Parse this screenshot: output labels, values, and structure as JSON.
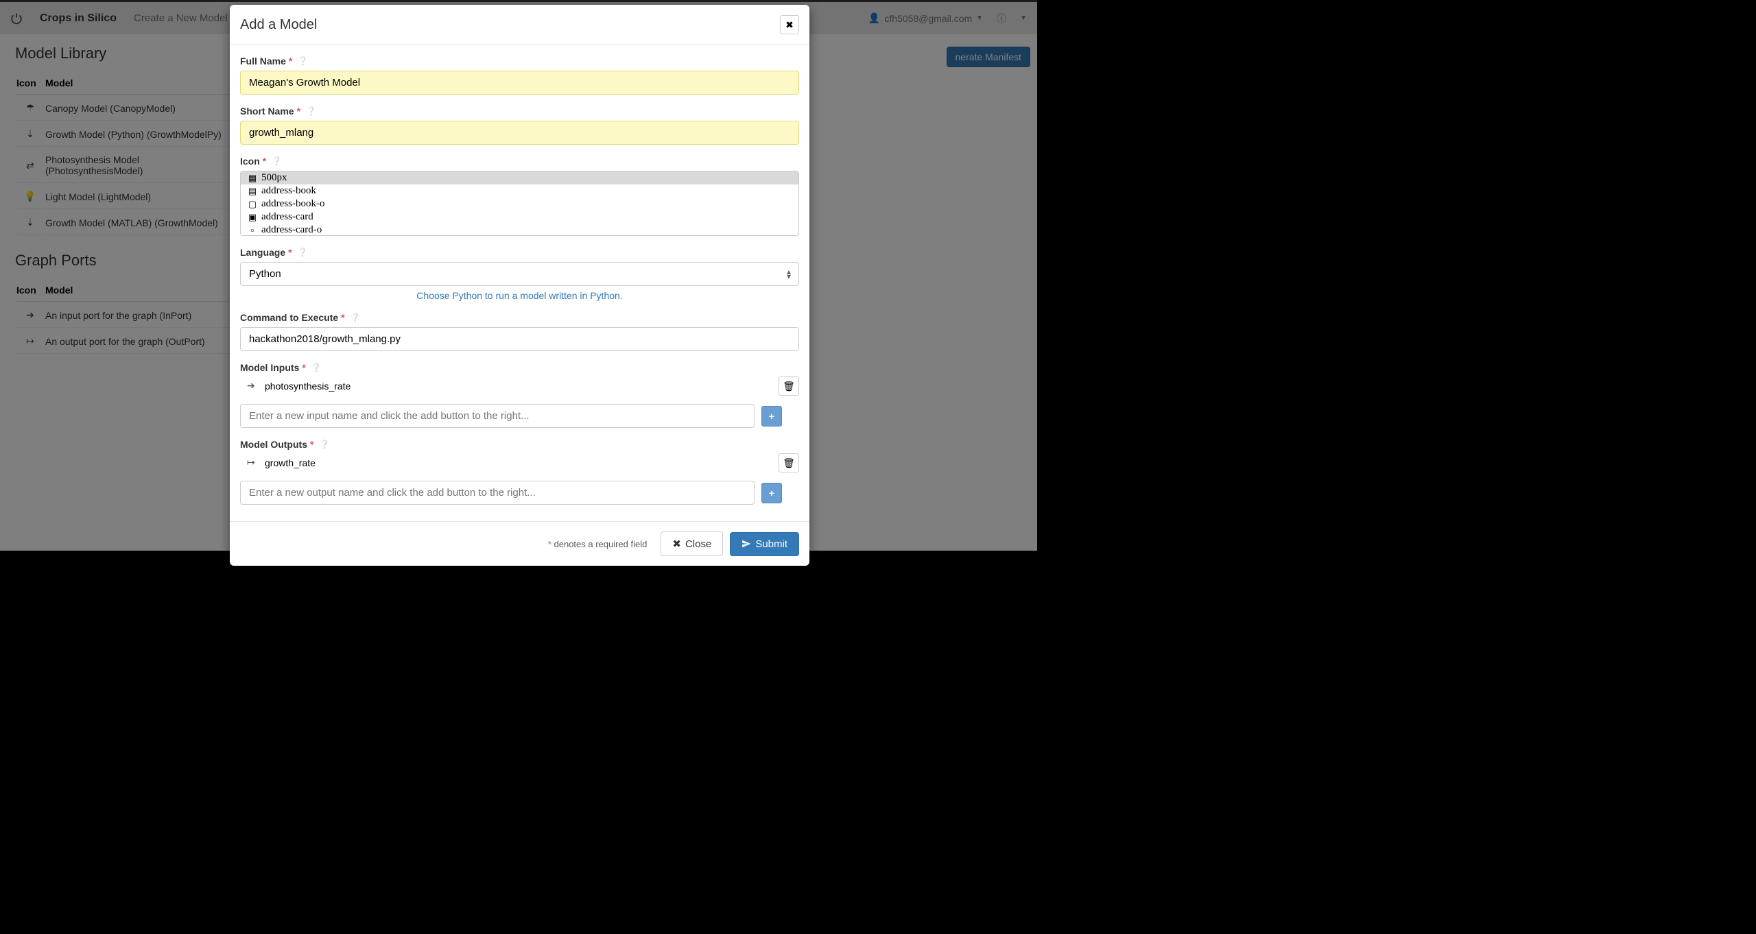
{
  "topbar": {
    "brand": "Crops in Silico",
    "nav_create": "Create a New Model",
    "user_email": "cfh5058@gmail.com"
  },
  "left_panel": {
    "library_title": "Model Library",
    "col_icon": "Icon",
    "col_model": "Model",
    "models": [
      {
        "icon": "☂",
        "label": "Canopy Model (CanopyModel)"
      },
      {
        "icon": "⇣",
        "label": "Growth Model (Python) (GrowthModelPy)"
      },
      {
        "icon": "⇄",
        "label": "Photosynthesis Model (PhotosynthesisModel)"
      },
      {
        "icon": "💡",
        "label": "Light Model (LightModel)"
      },
      {
        "icon": "⇣",
        "label": "Growth Model (MATLAB) (GrowthModel)"
      }
    ],
    "ports_title": "Graph Ports",
    "ports": [
      {
        "icon": "➔",
        "label": "An input port for the graph (InPort)"
      },
      {
        "icon": "↦",
        "label": "An output port for the graph (OutPort)"
      }
    ]
  },
  "canvas": {
    "generate_btn": "nerate Manifest"
  },
  "modal": {
    "title": "Add a Model",
    "full_name_label": "Full Name",
    "full_name_value": "Meagan's Growth Model",
    "short_name_label": "Short Name",
    "short_name_value": "growth_mlang",
    "icon_label": "Icon",
    "icon_options": [
      "500px",
      "address-book",
      "address-book-o",
      "address-card",
      "address-card-o"
    ],
    "icon_selected": "500px",
    "language_label": "Language",
    "language_value": "Python",
    "language_help": "Choose Python to run a model written in Python.",
    "command_label": "Command to Execute",
    "command_value": "hackathon2018/growth_mlang.py",
    "inputs_label": "Model Inputs",
    "inputs": [
      "photosynthesis_rate"
    ],
    "input_placeholder": "Enter a new input name and click the add button to the right...",
    "outputs_label": "Model Outputs",
    "outputs": [
      "growth_rate"
    ],
    "output_placeholder": "Enter a new output name and click the add button to the right...",
    "footnote": " denotes a required field",
    "close_btn": "Close",
    "submit_btn": "Submit"
  }
}
